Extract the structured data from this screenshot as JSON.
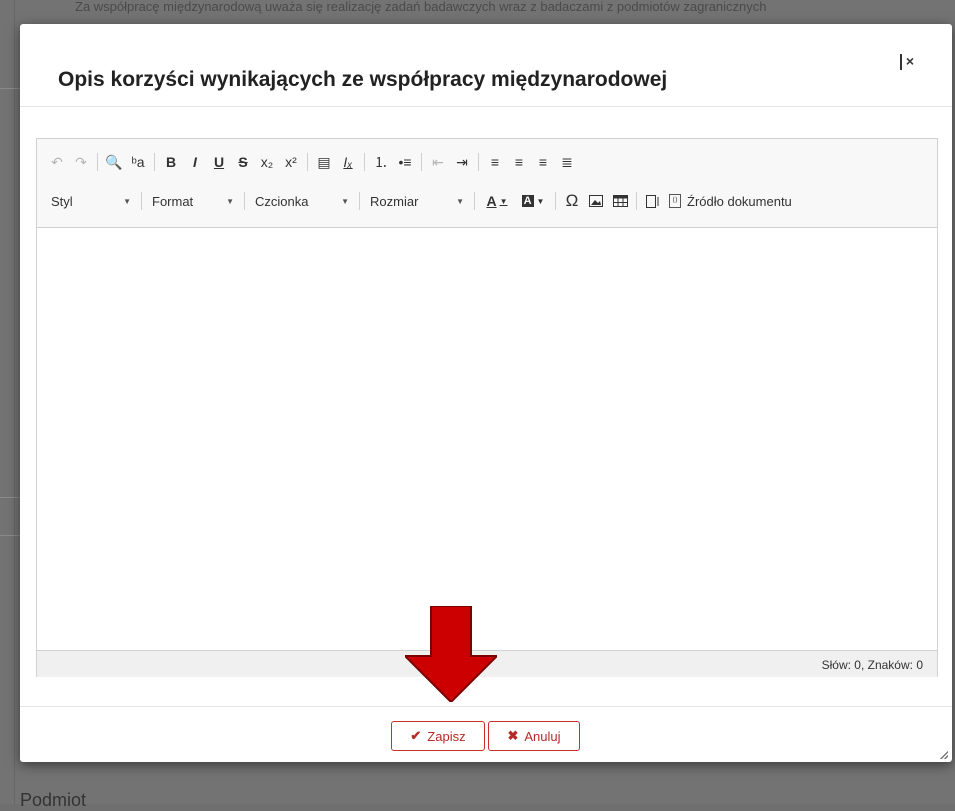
{
  "background": {
    "top_text": "Za współpracę międzynarodową uważa się realizację zadań badawczych wraz z badaczami z podmiotów zagranicznych",
    "bottom_text": "Podmiot"
  },
  "modal": {
    "title": "Opis korzyści wynikających ze współpracy międzynarodowej",
    "close_icon": "×"
  },
  "toolbar": {
    "row1_icons": [
      {
        "name": "undo-icon",
        "glyph": "↶",
        "dim": true
      },
      {
        "name": "redo-icon",
        "glyph": "↷",
        "dim": true
      },
      {
        "sep": true
      },
      {
        "name": "find-icon",
        "glyph": "🔍"
      },
      {
        "name": "replace-icon",
        "glyph": "ᵇa"
      },
      {
        "sep": true
      },
      {
        "name": "bold-icon",
        "glyph": "B"
      },
      {
        "name": "italic-icon",
        "glyph": "I"
      },
      {
        "name": "underline-icon",
        "glyph": "U"
      },
      {
        "name": "strikethrough-icon",
        "glyph": "S"
      },
      {
        "name": "subscript-icon",
        "glyph": "x₂"
      },
      {
        "name": "superscript-icon",
        "glyph": "x²"
      },
      {
        "sep": true
      },
      {
        "name": "copy-format-icon",
        "glyph": "▤"
      },
      {
        "name": "remove-format-icon",
        "glyph": "Iₓ"
      },
      {
        "sep": true
      },
      {
        "name": "numbered-list-icon",
        "glyph": "⒈"
      },
      {
        "name": "bulleted-list-icon",
        "glyph": "•≡"
      },
      {
        "sep": true
      },
      {
        "name": "outdent-icon",
        "glyph": "⇤",
        "dim": true
      },
      {
        "name": "indent-icon",
        "glyph": "⇥"
      },
      {
        "sep": true
      },
      {
        "name": "align-left-icon",
        "glyph": "≡"
      },
      {
        "name": "align-center-icon",
        "glyph": "≡"
      },
      {
        "name": "align-right-icon",
        "glyph": "≡"
      },
      {
        "name": "align-justify-icon",
        "glyph": "≣"
      }
    ],
    "style_label": "Styl",
    "format_label": "Format",
    "font_label": "Czcionka",
    "size_label": "Rozmiar",
    "text_color_glyph": "A",
    "bg_color_glyph": "A",
    "special_char_glyph": "Ω",
    "source_label": "Źródło dokumentu"
  },
  "editor": {
    "content": "",
    "word_count": "Słów: 0, Znaków: 0"
  },
  "footer": {
    "save_label": "Zapisz",
    "cancel_label": "Anuluj"
  },
  "colors": {
    "button_accent": "#c9302c",
    "arrow_red": "#cc0000"
  }
}
